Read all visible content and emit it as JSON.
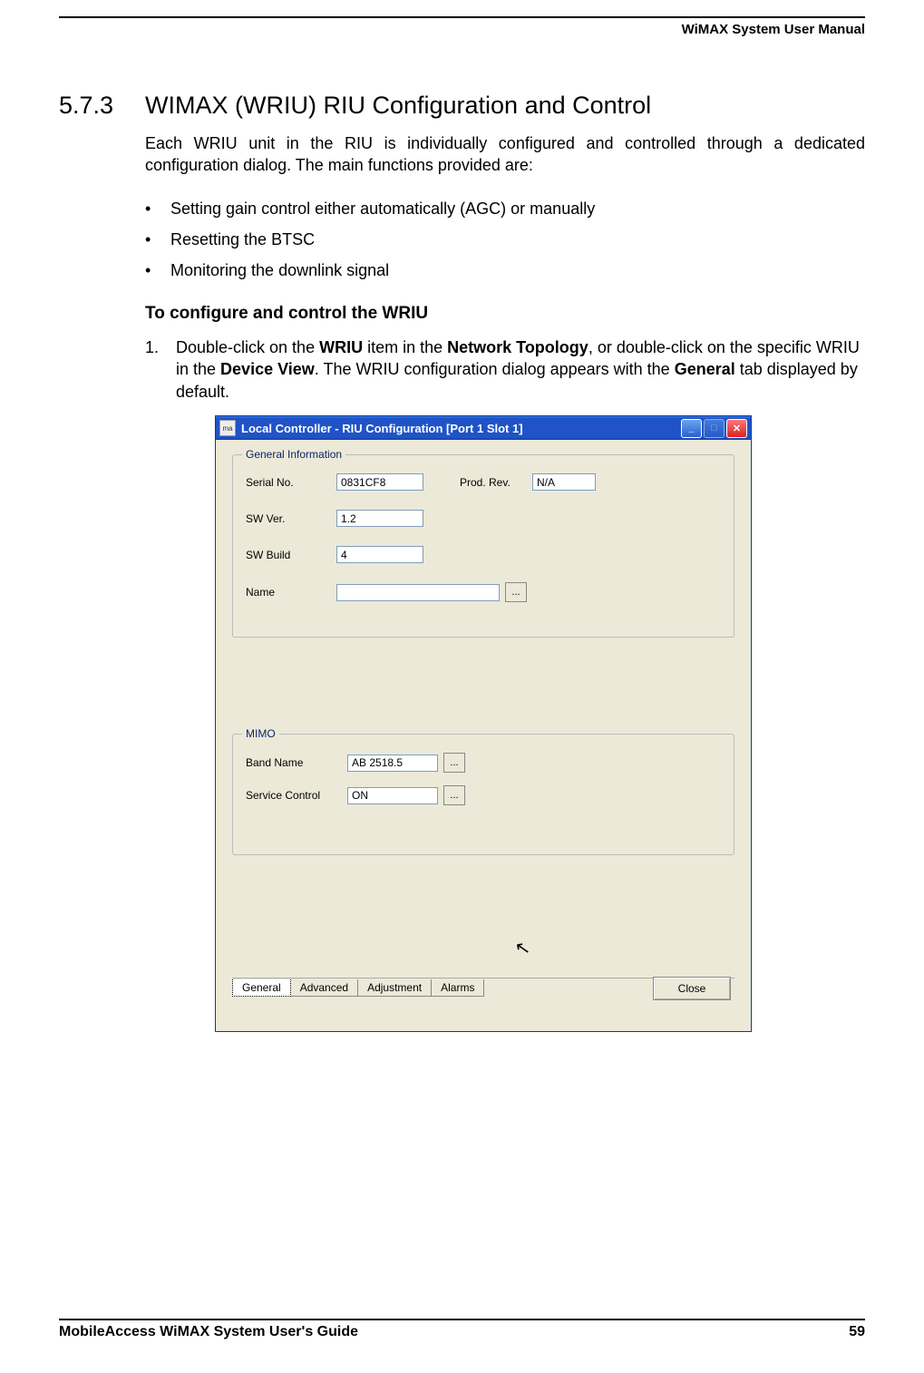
{
  "header": {
    "doc_title": "WiMAX System User Manual"
  },
  "section": {
    "number": "5.7.3",
    "title": "WIMAX (WRIU) RIU Configuration and Control",
    "intro": "Each WRIU unit in the RIU is individually configured and controlled through a dedicated configuration dialog. The main functions provided are:",
    "bullets": [
      "Setting gain control either automatically (AGC) or manually",
      "Resetting the BTSC",
      "Monitoring the downlink signal"
    ],
    "sub_heading": "To configure and control the WRIU",
    "step1_num": "1.",
    "step1_pre": "Double-click on the ",
    "step1_b1": "WRIU",
    "step1_mid1": " item in the ",
    "step1_b2": "Network Topology",
    "step1_mid2": ", or double-click on the specific WRIU in the ",
    "step1_b3": "Device View",
    "step1_mid3": ". The WRIU configuration dialog appears with the ",
    "step1_b4": "General",
    "step1_post": " tab displayed by default."
  },
  "dialog": {
    "app_icon_text": "ma",
    "title": "Local Controller - RIU Configuration [Port 1  Slot 1]",
    "min_label": "_",
    "max_label": "□",
    "close_x": "✕",
    "general_legend": "General Information",
    "serial_label": "Serial No.",
    "serial_value": "0831CF8",
    "prod_label": "Prod. Rev.",
    "prod_value": "N/A",
    "swver_label": "SW Ver.",
    "swver_value": "1.2",
    "swbuild_label": "SW Build",
    "swbuild_value": "4",
    "name_label": "Name",
    "name_value": "",
    "ellipsis": "...",
    "mimo_legend": "MIMO",
    "band_label": "Band Name",
    "band_value": "AB 2518.5",
    "service_label": "Service Control",
    "service_value": "ON",
    "tabs": {
      "general": "General",
      "advanced": "Advanced",
      "adjustment": "Adjustment",
      "alarms": "Alarms"
    },
    "close_btn": "Close"
  },
  "footer": {
    "guide": "MobileAccess WiMAX System User's Guide",
    "page": "59"
  }
}
